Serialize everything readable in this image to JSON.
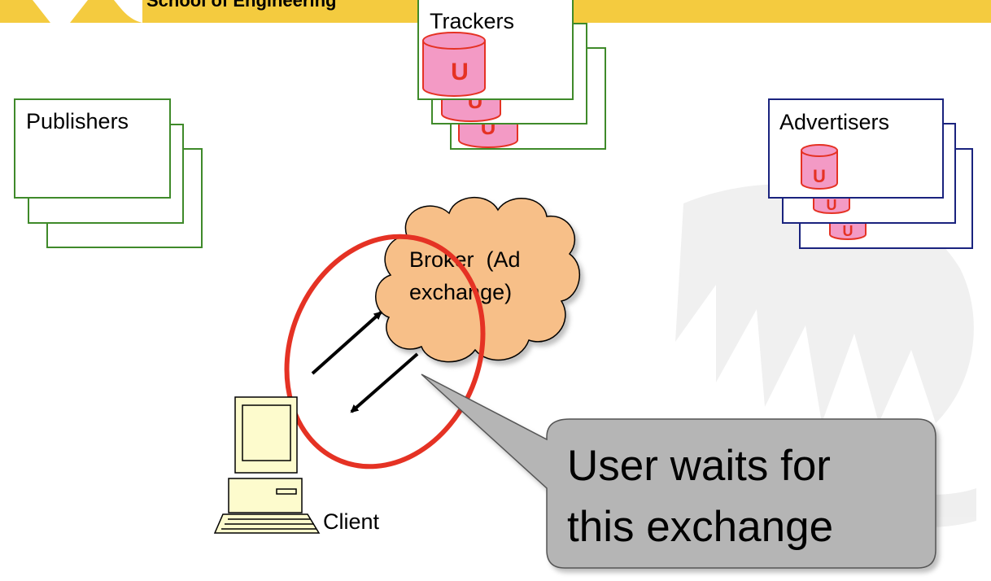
{
  "header": {
    "school": "School of Engineering",
    "bar_color": "#f4cb3f"
  },
  "groups": {
    "publishers": {
      "label": "Publishers",
      "border_color": "#3f8a2a"
    },
    "trackers": {
      "label": "Trackers",
      "border_color": "#3f8a2a",
      "db_label": "U"
    },
    "advertisers": {
      "label": "Advertisers",
      "border_color": "#1a237e",
      "db_label": "U"
    }
  },
  "broker": {
    "label_line1": "Broker  (Ad",
    "label_line2": "exchange)",
    "fill_color": "#f7bf88"
  },
  "client": {
    "label": "Client",
    "icon": "computer-icon"
  },
  "callout": {
    "line1": "User waits for",
    "line2": "this exchange",
    "fill_color": "#b5b5b5"
  },
  "highlight": {
    "color": "#e53224"
  },
  "colors": {
    "db_fill": "#f39ac5",
    "db_stroke": "#e53224"
  }
}
